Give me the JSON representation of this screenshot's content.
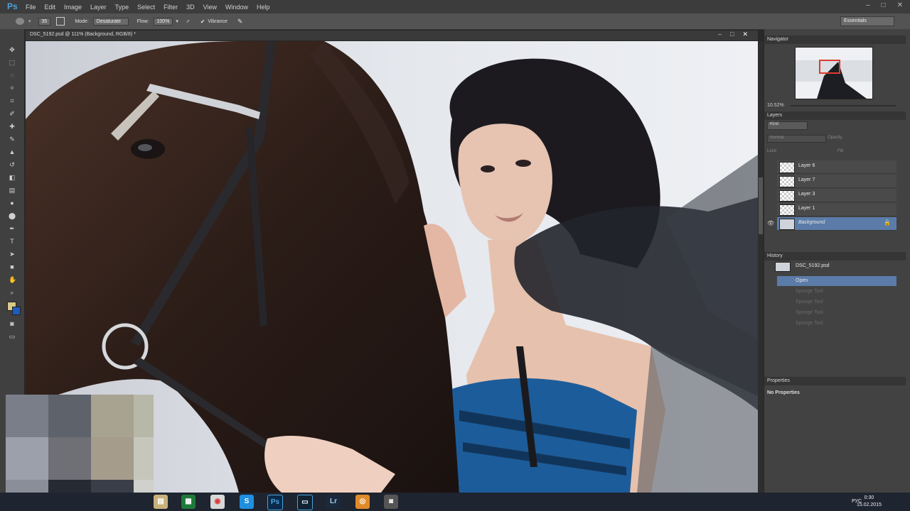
{
  "menubar": {
    "logo": "Ps",
    "items": [
      "File",
      "Edit",
      "Image",
      "Layer",
      "Type",
      "Select",
      "Filter",
      "3D",
      "View",
      "Window",
      "Help"
    ]
  },
  "options": {
    "brush_size": "35",
    "mode_label": "Mode:",
    "mode_value": "Desaturate",
    "flow_label": "Flow:",
    "flow_value": "100%",
    "vibrance_label": "Vibrance",
    "workspace": "Essentials"
  },
  "document": {
    "tab_title": "DSC_5192.psd @ 111% (Background, RGB/8) *"
  },
  "navigator": {
    "title": "Navigator",
    "zoom": "10.52%"
  },
  "layers": {
    "title": "Layers",
    "filter": "Kind",
    "blend": "Normal",
    "opacity_label": "Opacity:",
    "lock_label": "Lock:",
    "fill_label": "Fill:",
    "items": [
      {
        "name": "Layer 6",
        "selected": false
      },
      {
        "name": "Layer 7",
        "selected": false
      },
      {
        "name": "Layer 3",
        "selected": false
      },
      {
        "name": "Layer 1",
        "selected": false
      },
      {
        "name": "Background",
        "selected": true
      }
    ]
  },
  "history": {
    "title": "History",
    "snapshot": "DSC_5192.psd",
    "items": [
      {
        "name": "Open",
        "selected": true,
        "dim": false
      },
      {
        "name": "Sponge Tool",
        "selected": false,
        "dim": true
      },
      {
        "name": "Sponge Tool",
        "selected": false,
        "dim": true
      },
      {
        "name": "Sponge Tool",
        "selected": false,
        "dim": true
      },
      {
        "name": "Sponge Tool",
        "selected": false,
        "dim": true
      }
    ]
  },
  "properties": {
    "title": "Properties",
    "content": "No Properties"
  },
  "taskbar": {
    "lang": "РУС",
    "time": "0:30",
    "date": "15.02.2015"
  },
  "colors": {
    "accent": "#5b7ca8",
    "ps_blue": "#4aa3df"
  }
}
